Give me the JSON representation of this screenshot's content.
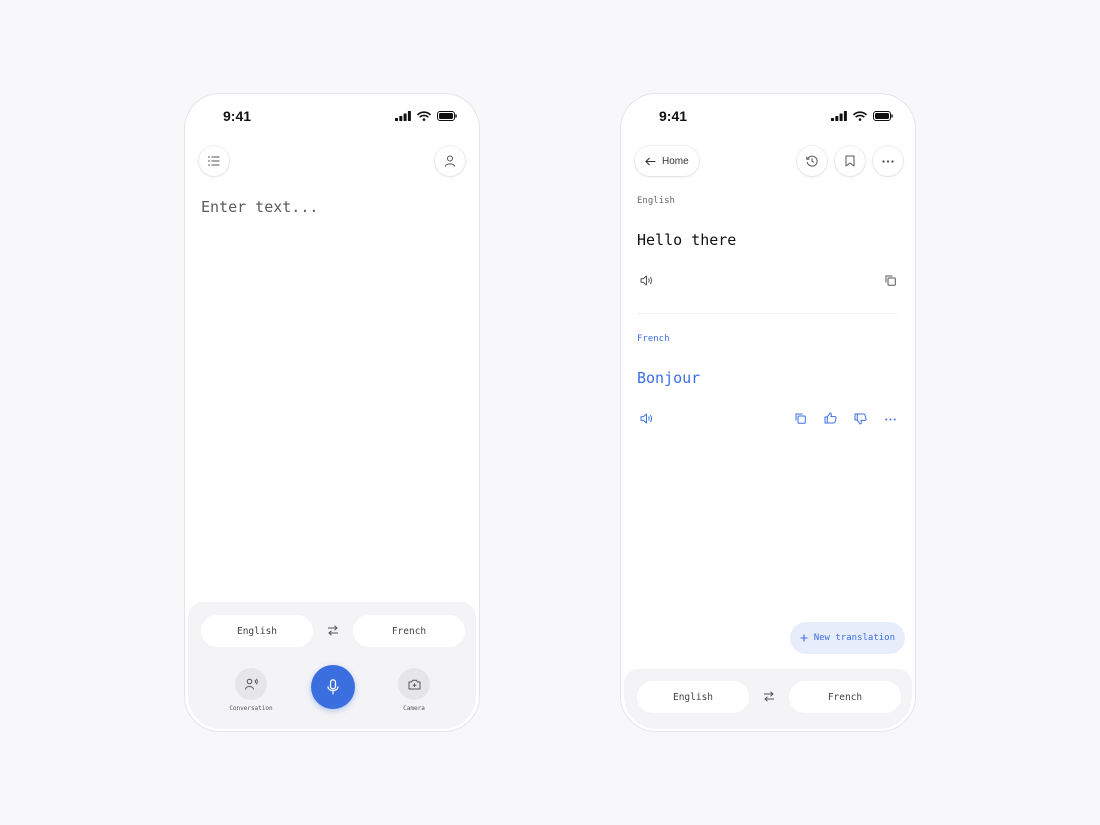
{
  "colors": {
    "accent": "#3b6fe0",
    "background": "#f8f7fa",
    "panel": "#f4f3f6"
  },
  "screen_input": {
    "status": {
      "time": "9:41",
      "icons": [
        "signal-icon",
        "wifi-icon",
        "battery-icon"
      ]
    },
    "header": {
      "left_icon": "list-icon",
      "right_icon": "user-icon"
    },
    "input": {
      "placeholder": "Enter text..."
    },
    "language_bar": {
      "source": "English",
      "target": "French",
      "swap_icon": "swap-arrows-icon"
    },
    "actions": {
      "conversation_label": "Conversation",
      "camera_label": "Camera",
      "mic_icon": "microphone-icon"
    }
  },
  "screen_result": {
    "status": {
      "time": "9:41"
    },
    "header": {
      "back_label": "Home",
      "icons": [
        "history-icon",
        "bookmark-icon",
        "more-icon"
      ]
    },
    "source": {
      "language": "English",
      "text": "Hello there"
    },
    "target": {
      "language": "French",
      "text": "Bonjour"
    },
    "new_translation_label": "New translation",
    "language_bar": {
      "source": "English",
      "target": "French"
    }
  }
}
